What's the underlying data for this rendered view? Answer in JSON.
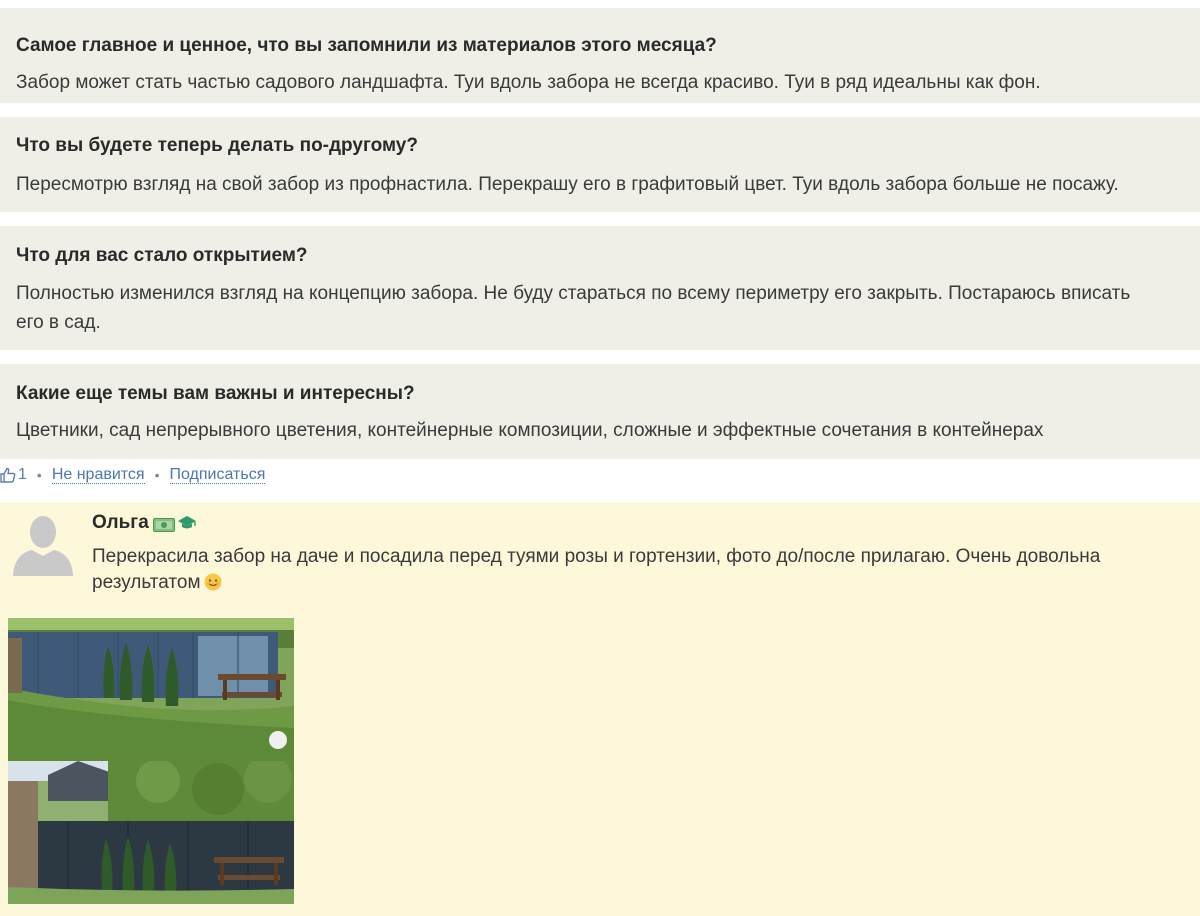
{
  "qa": [
    {
      "question": "Самое главное и ценное, что вы запомнили из материалов этого месяца?",
      "answer": "Забор может стать частью садового ландшафта. Туи вдоль забора не всегда красиво. Туи в ряд идеальны как фон."
    },
    {
      "question": "Что вы будете теперь делать по-другому?",
      "answer": "Пересмотрю взгляд на свой забор из профнастила. Перекрашу его в графитовый цвет. Туи вдоль забора больше не посажу."
    },
    {
      "question": "Что для вас стало открытием?",
      "answer": "Полностью изменился взгляд на концепцию забора. Не буду стараться по всему периметру его закрыть. Постараюсь вписать его в сад."
    },
    {
      "question": "Какие еще темы вам важны и интересны?",
      "answer": "Цветники, сад непрерывного цветения, контейнерные композиции, сложные и эффектные сочетания в контейнерах"
    }
  ],
  "actions": {
    "like_icon": "thumbs-up-icon",
    "like_count": "1",
    "separator": "•",
    "dislike_label": "Не нравится",
    "subscribe_label": "Подписаться"
  },
  "comment": {
    "author": "Ольга",
    "badges": [
      "money-badge-icon",
      "graduation-cap-icon"
    ],
    "text": "Перекрасила забор на даче и посадила перед туями розы и гортензии, фото до/после прилагаю. Очень довольна результатом",
    "emoji": "smiling-face-icon",
    "photos": [
      "garden-fence-photo-before",
      "garden-fence-photo-after"
    ]
  },
  "colors": {
    "qa_background": "#efefe8",
    "comment_background": "#fcf8d9",
    "link": "#4a78b0",
    "text": "#333333"
  }
}
